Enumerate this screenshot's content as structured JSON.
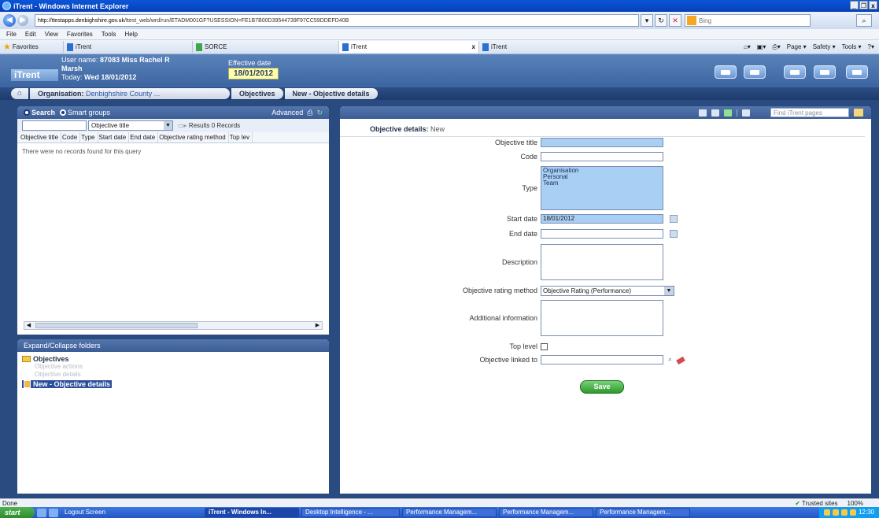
{
  "browser": {
    "title": "iTrent - Windows Internet Explorer",
    "window_buttons": [
      "_",
      "❐",
      "x"
    ],
    "url_host": "http://ttestapps.denbighshire.gov.uk",
    "url_path": "/ttest_web/wrd/run/ETADM001GF?USESSION=FE1B7B00D39544739F97CC59DDEFD40B",
    "search_engine": "Bing",
    "menu": [
      "File",
      "Edit",
      "View",
      "Favorites",
      "Tools",
      "Help"
    ],
    "favorites_label": "Favorites",
    "tabs": [
      "iTrent",
      "SORCE",
      "iTrent",
      "iTrent"
    ],
    "tab_close": "x",
    "tools": [
      "Page ▾",
      "Safety ▾",
      "Tools ▾"
    ]
  },
  "header": {
    "logo": "iTrent",
    "user_label": "User name:",
    "user_name": "87083 Miss Rachel R",
    "user_name_2": "Marsh",
    "today_label": "Today:",
    "today": "Wed 18/01/2012",
    "effective_label": "Effective date",
    "effective_date": "18/01/2012"
  },
  "breadcrumb": {
    "home": "⌂",
    "org_label": "Organisation:",
    "org_value": "Denbighshire County ...",
    "objectives": "Objectives",
    "new_detail": "New - Objective details"
  },
  "search": {
    "search_mode": "Search",
    "smart_groups": "Smart groups",
    "advanced": "Advanced",
    "field": "Objective title",
    "results": "Results 0 Records",
    "columns": [
      "Objective title",
      "Code",
      "Type",
      "Start date",
      "End date",
      "Objective rating method",
      "Top lev"
    ],
    "no_records": "There were no records found for this query"
  },
  "folders": {
    "header": "Expand/Collapse folders",
    "root": "Objectives",
    "children": [
      "Objective actions",
      "Objective details"
    ],
    "selected": "New - Objective details"
  },
  "detail": {
    "find_placeholder": "Find iTrent pages",
    "title": "Objective details:",
    "title_state": "New",
    "labels": {
      "objective_title": "Objective title",
      "code": "Code",
      "type": "Type",
      "start_date": "Start date",
      "end_date": "End date",
      "description": "Description",
      "rating_method": "Objective rating method",
      "additional_info": "Additional information",
      "top_level": "Top level",
      "linked_to": "Objective linked to"
    },
    "type_options": [
      "Organisation",
      "Personal",
      "Team"
    ],
    "start_date": "18/01/2012",
    "rating_method": "Objective Rating (Performance)",
    "save": "Save"
  },
  "status": {
    "text": "Done",
    "zone": "Trusted sites",
    "zoom": "100%"
  },
  "taskbar": {
    "start": "start",
    "logout": "Logout Screen",
    "tasks": [
      "iTrent - Windows In...",
      "Desktop Intelligence - ...",
      "Performance Managem...",
      "Performance Managem...",
      "Performance Managem..."
    ],
    "clock": "12:30"
  }
}
